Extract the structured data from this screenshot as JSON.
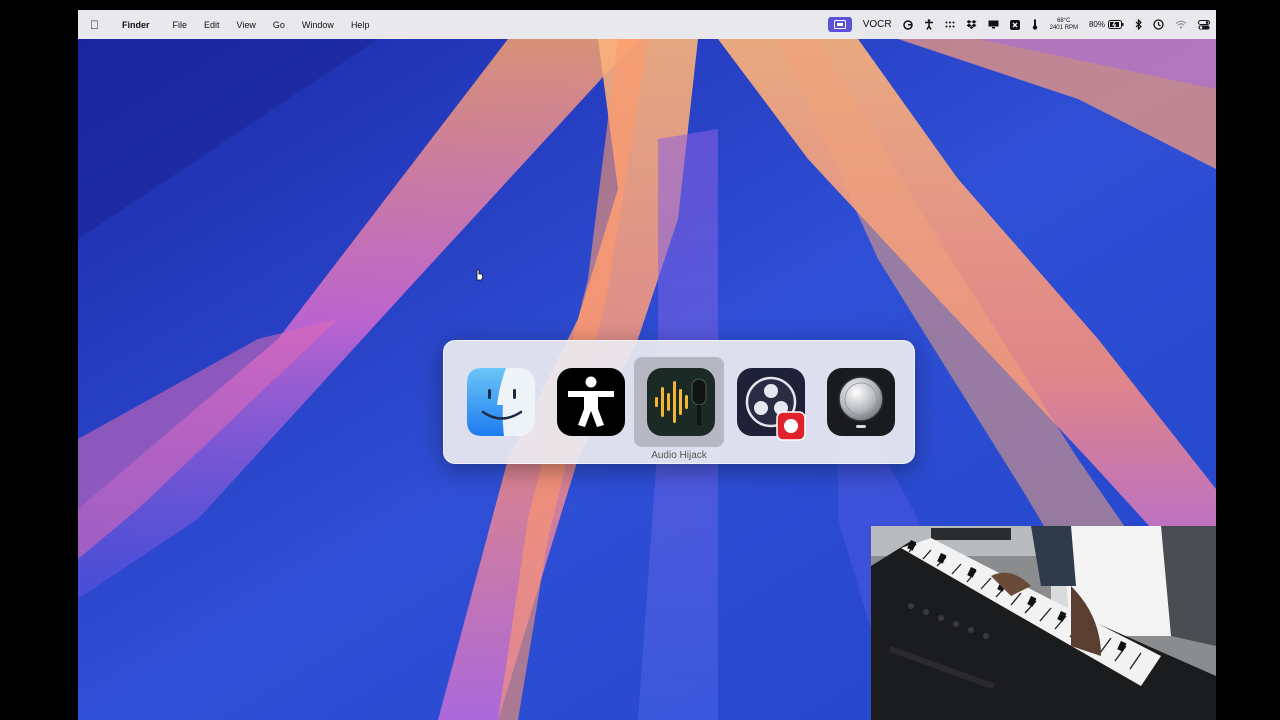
{
  "menubar": {
    "apple_icon": "apple-icon",
    "app_name": "Finder",
    "menus": [
      "File",
      "Edit",
      "View",
      "Go",
      "Window",
      "Help"
    ],
    "vocr_label": "VOCR",
    "temperature": "68°C",
    "fan_rpm": "2401 RPM",
    "battery_percent": "80%"
  },
  "app_switcher": {
    "apps": [
      {
        "name": "Finder",
        "icon": "finder-icon"
      },
      {
        "name": "Accessibility Inspector",
        "icon": "accessibility-icon"
      },
      {
        "name": "Audio Hijack",
        "icon": "audio-hijack-icon"
      },
      {
        "name": "OBS",
        "icon": "obs-icon"
      },
      {
        "name": "Logic Pro",
        "icon": "logic-pro-icon"
      }
    ],
    "selected_label": "Audio Hijack"
  },
  "colors": {
    "menubar_bg": "#e9e8ec",
    "vocr_accent": "#5b52d8",
    "record_red": "#e0222c",
    "wallpaper_blue": "#2f4fd6",
    "wallpaper_orange": "#f7a06b"
  }
}
